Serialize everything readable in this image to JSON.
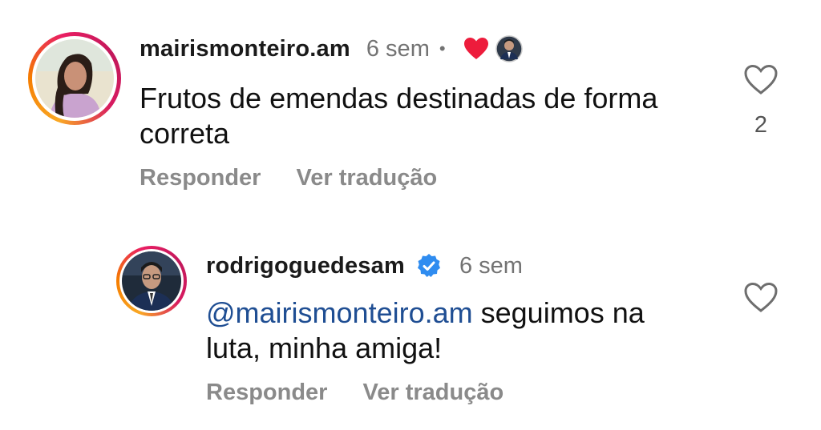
{
  "comments": [
    {
      "username": "mairismonteiro.am",
      "time": "6 sem",
      "separator": "•",
      "text": "Frutos de emendas destinadas de forma correta",
      "like_count": "2",
      "actions": {
        "reply": "Responder",
        "translate": "Ver tradução"
      },
      "liked_by_author": true
    },
    {
      "username": "rodrigoguedesam",
      "verified": true,
      "time": "6 sem",
      "mention": "@mairismonteiro.am",
      "text": " seguimos na luta, minha amiga!",
      "actions": {
        "reply": "Responder",
        "translate": "Ver tradução"
      }
    }
  ],
  "colors": {
    "heart_red": "#ed1c3c",
    "verified_blue": "#2f8cf0",
    "mention_blue": "#1f4e93"
  }
}
